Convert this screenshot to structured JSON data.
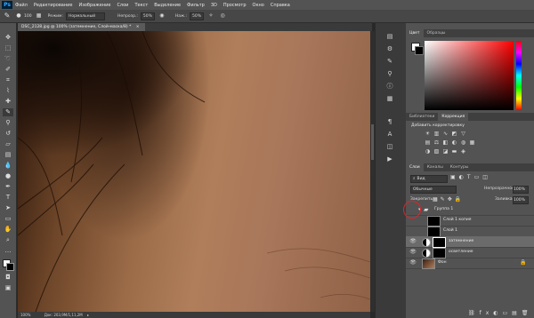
{
  "app": {
    "logo": "Ps"
  },
  "menu": [
    "Файл",
    "Редактирование",
    "Изображение",
    "Слои",
    "Текст",
    "Выделение",
    "Фильтр",
    "3D",
    "Просмотр",
    "Окно",
    "Справка"
  ],
  "options": {
    "brush_size": "100",
    "mode_label": "Режим:",
    "mode_value": "Нормальный",
    "opacity_label": "Непрозр.:",
    "opacity_value": "50%",
    "flow_label": "Наж.:",
    "flow_value": "50%"
  },
  "document": {
    "tab_title": "DSC_2128.jpg @ 100% (затемнение, Слой-маска/8) *",
    "zoom": "100%",
    "doc_info": "Док: 203,9M/1,11,2M"
  },
  "panels": {
    "color_tabs": [
      "Цвет",
      "Образцы"
    ],
    "adjust_tabs": [
      "Библиотеки",
      "Коррекция"
    ],
    "adjust_hint": "Добавить корректировку",
    "layers_tabs": [
      "Слои",
      "Каналы",
      "Контуры"
    ],
    "layer_filter_label": "Вид",
    "blend_mode": "Обычные",
    "opacity_label": "Непрозрачность:",
    "opacity_value": "100%",
    "lock_label": "Закрепить:",
    "fill_label": "Заливка:",
    "fill_value": "100%"
  },
  "layers": [
    {
      "name": "Группа 1",
      "kind": "group"
    },
    {
      "name": "Слой 1 копия",
      "kind": "layer"
    },
    {
      "name": "Слой 1",
      "kind": "layer"
    },
    {
      "name": "затемнение",
      "kind": "adjustment"
    },
    {
      "name": "осветление",
      "kind": "adjustment"
    },
    {
      "name": "Фон",
      "kind": "background"
    }
  ],
  "colors": {
    "accent_red": "#e0242a"
  }
}
